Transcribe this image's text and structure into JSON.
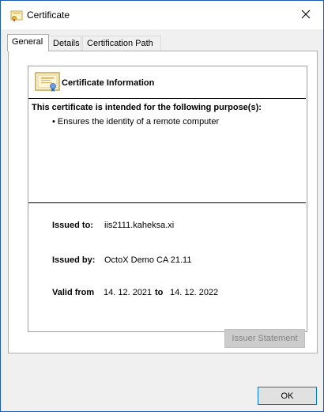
{
  "window": {
    "title": "Certificate",
    "close_icon": "close-icon",
    "title_icon": "certificate-icon"
  },
  "tabs": [
    {
      "label": "General",
      "active": true
    },
    {
      "label": "Details",
      "active": false
    },
    {
      "label": "Certification Path",
      "active": false
    }
  ],
  "general": {
    "info_title": "Certificate Information",
    "purpose_heading": "This certificate is intended for the following purpose(s):",
    "purposes": [
      "Ensures the identity of a remote computer"
    ],
    "issued_to_label": "Issued to:",
    "issued_to": "iis2111.kaheksa.xi",
    "issued_by_label": "Issued by:",
    "issued_by": "OctoX Demo CA 21.11",
    "valid_from_label": "Valid from",
    "valid_from": "14. 12. 2021",
    "valid_to_label": "to",
    "valid_to": "14. 12. 2022"
  },
  "buttons": {
    "issuer_statement": "Issuer Statement",
    "ok": "OK"
  },
  "colors": {
    "accent": "#0078d7",
    "disabled_button_bg": "#cccccc",
    "disabled_button_text": "#838383"
  }
}
